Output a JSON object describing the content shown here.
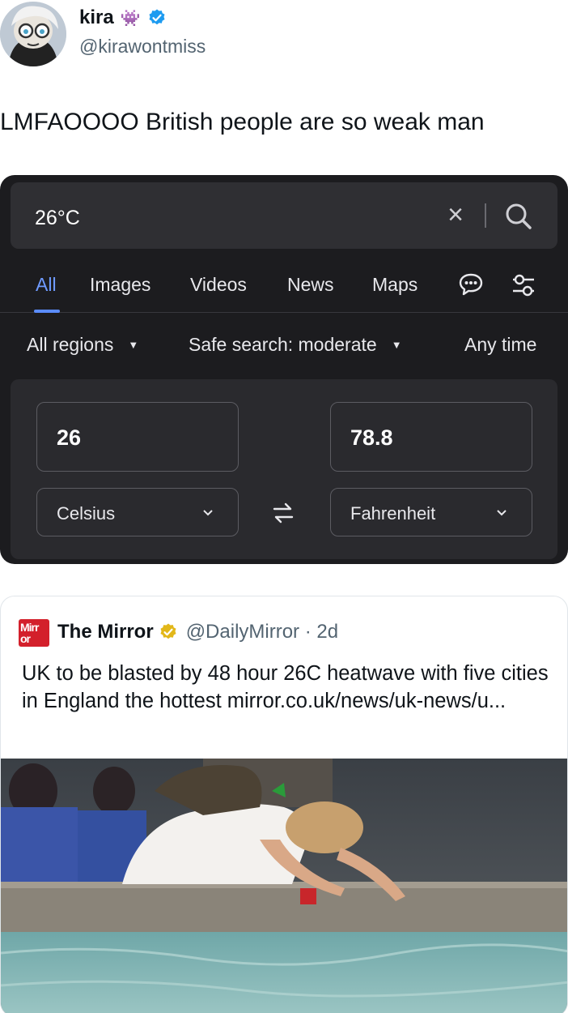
{
  "tweet": {
    "author_name": "kira",
    "author_emoji": "👾",
    "handle": "@kirawontmiss",
    "text": "LMFAOOOO British people are so weak man"
  },
  "search": {
    "query": "26°C",
    "tabs": [
      "All",
      "Images",
      "Videos",
      "News",
      "Maps"
    ],
    "active_tab": "All",
    "filters": {
      "regions": "All regions",
      "safe_search": "Safe search: moderate",
      "time": "Any time"
    },
    "converter": {
      "from_value": "26",
      "to_value": "78.8",
      "from_unit": "Celsius",
      "to_unit": "Fahrenheit"
    }
  },
  "quoted": {
    "logo_text": "Mirr or",
    "name": "The Mirror",
    "handle_time": "@DailyMirror · 2d",
    "text": "UK to be blasted by 48 hour 26C heatwave with five cities in England the hottest mirror.co.uk/news/uk-news/u..."
  },
  "colors": {
    "verified_blue": "#1d9bf0",
    "verified_gold": "#e2b719",
    "active_tab": "#6f9bff",
    "panel_bg": "#1c1c1f",
    "mirror_red": "#d3202b"
  }
}
